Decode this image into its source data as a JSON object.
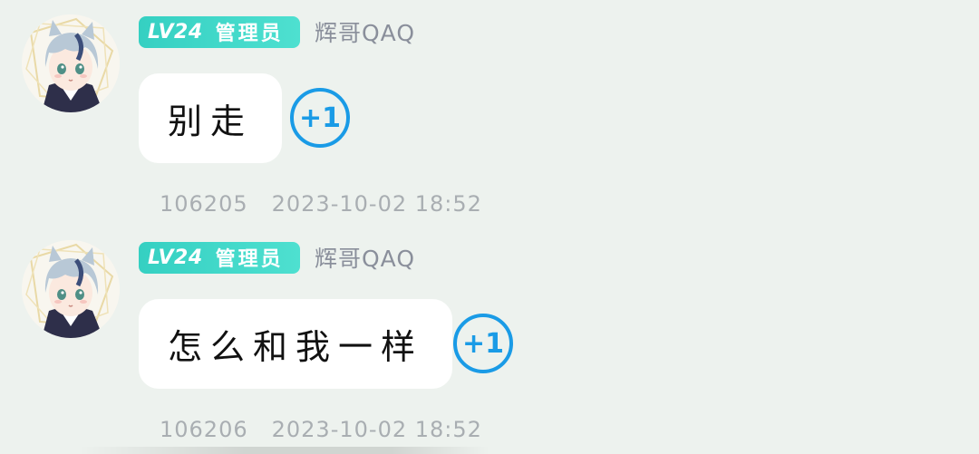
{
  "messages": [
    {
      "badge": {
        "level": "LV24",
        "role": "管理员"
      },
      "username": "辉哥QAQ",
      "text": "别走",
      "plus_one": "+1",
      "floor": "106205",
      "time": "2023-10-02 18:52"
    },
    {
      "badge": {
        "level": "LV24",
        "role": "管理员"
      },
      "username": "辉哥QAQ",
      "text": "怎么和我一样",
      "plus_one": "+1",
      "floor": "106206",
      "time": "2023-10-02 18:52"
    }
  ],
  "colors": {
    "background": "#edf2ee",
    "badge": "#35d0c2",
    "accent": "#1a9be6",
    "meta_text": "#a9aeb2"
  },
  "icons": {
    "avatar": "anime-avatar",
    "plus_one": "plus-one-icon"
  }
}
